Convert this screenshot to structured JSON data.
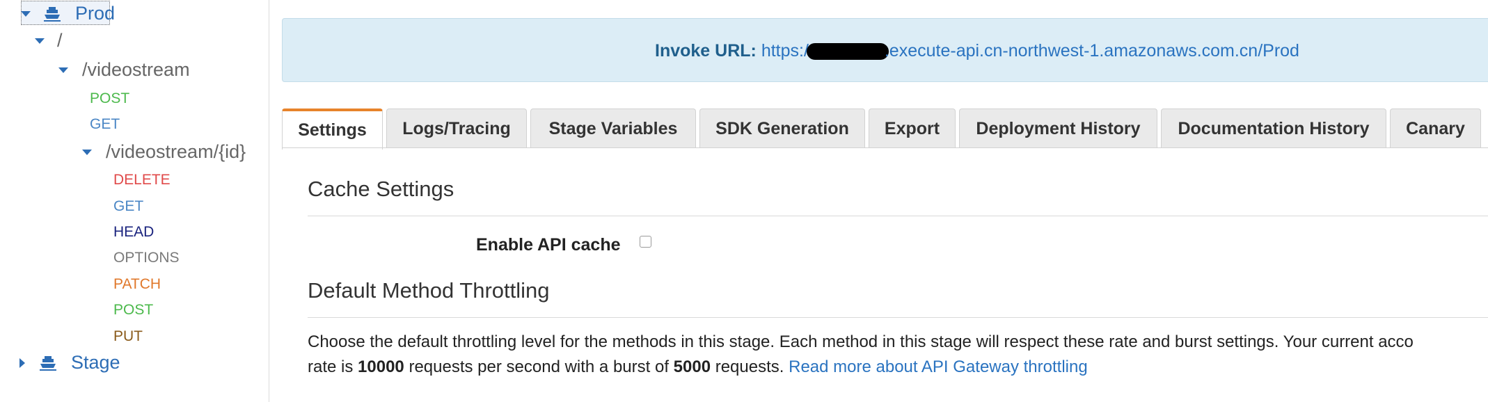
{
  "sidebar": {
    "prod_label": "Prod",
    "root_path": "/",
    "videostream_path": "/videostream",
    "videostream_methods": [
      "POST",
      "GET"
    ],
    "videostream_id_path": "/videostream/{id}",
    "videostream_id_methods": [
      "DELETE",
      "GET",
      "HEAD",
      "OPTIONS",
      "PATCH",
      "POST",
      "PUT"
    ],
    "stage_label": "Stage"
  },
  "colors": {
    "post": "#4cb94c",
    "get": "#4a86c5",
    "delete": "#e04a4a",
    "head": "#1a237e",
    "options": "#7a7a7a",
    "patch": "#e0782b",
    "put": "#8a5a1a",
    "accent_tab": "#e7832b",
    "link": "#2a73c0",
    "invoke_bg": "#dcedf6"
  },
  "invoke": {
    "label": "Invoke URL:",
    "url_prefix": "https://",
    "url_suffix": ".execute-api.cn-northwest-1.amazonaws.com.cn/Prod"
  },
  "tabs": [
    "Settings",
    "Logs/Tracing",
    "Stage Variables",
    "SDK Generation",
    "Export",
    "Deployment History",
    "Documentation History",
    "Canary"
  ],
  "active_tab": "Settings",
  "cache": {
    "title": "Cache Settings",
    "enable_label": "Enable API cache",
    "enabled": false
  },
  "throttling": {
    "title": "Default Method Throttling",
    "line1": "Choose the default throttling level for the methods in this stage. Each method in this stage will respect these rate and burst settings. Your current acco",
    "line2_a": "rate is ",
    "rate": "10000",
    "line2_b": " requests per second with a burst of ",
    "burst": "5000",
    "line2_c": " requests. ",
    "link_text": "Read more about API Gateway throttling"
  }
}
